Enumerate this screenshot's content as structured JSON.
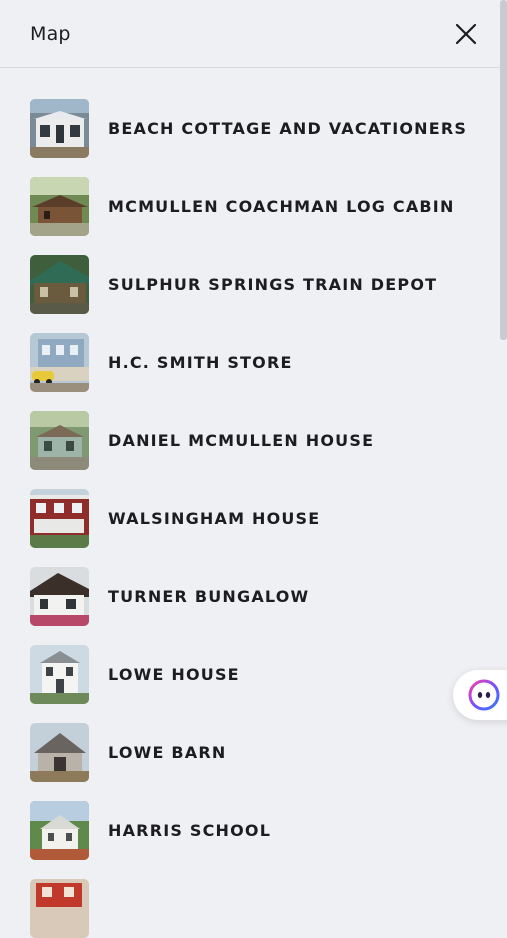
{
  "header": {
    "title": "Map",
    "close_icon": "close-icon"
  },
  "items": [
    {
      "label": "BEACH COTTAGE AND VACATIONERS",
      "thumb": "cottage"
    },
    {
      "label": "MCMULLEN COACHMAN LOG CABIN",
      "thumb": "cabin"
    },
    {
      "label": "SULPHUR SPRINGS TRAIN DEPOT",
      "thumb": "depot"
    },
    {
      "label": "H.C. SMITH STORE",
      "thumb": "store"
    },
    {
      "label": "DANIEL MCMULLEN HOUSE",
      "thumb": "house"
    },
    {
      "label": "WALSINGHAM HOUSE",
      "thumb": "redhouse"
    },
    {
      "label": "TURNER BUNGALOW",
      "thumb": "bungalow"
    },
    {
      "label": "LOWE HOUSE",
      "thumb": "whitehouse"
    },
    {
      "label": "LOWE BARN",
      "thumb": "barn"
    },
    {
      "label": "HARRIS SCHOOL",
      "thumb": "school"
    },
    {
      "label": "",
      "thumb": "partial"
    }
  ],
  "assistant": {
    "icon": "chat-assistant-icon"
  },
  "colors": {
    "background": "#eff0f4",
    "text": "#1d1d1f",
    "accent": "#6a4cff"
  }
}
